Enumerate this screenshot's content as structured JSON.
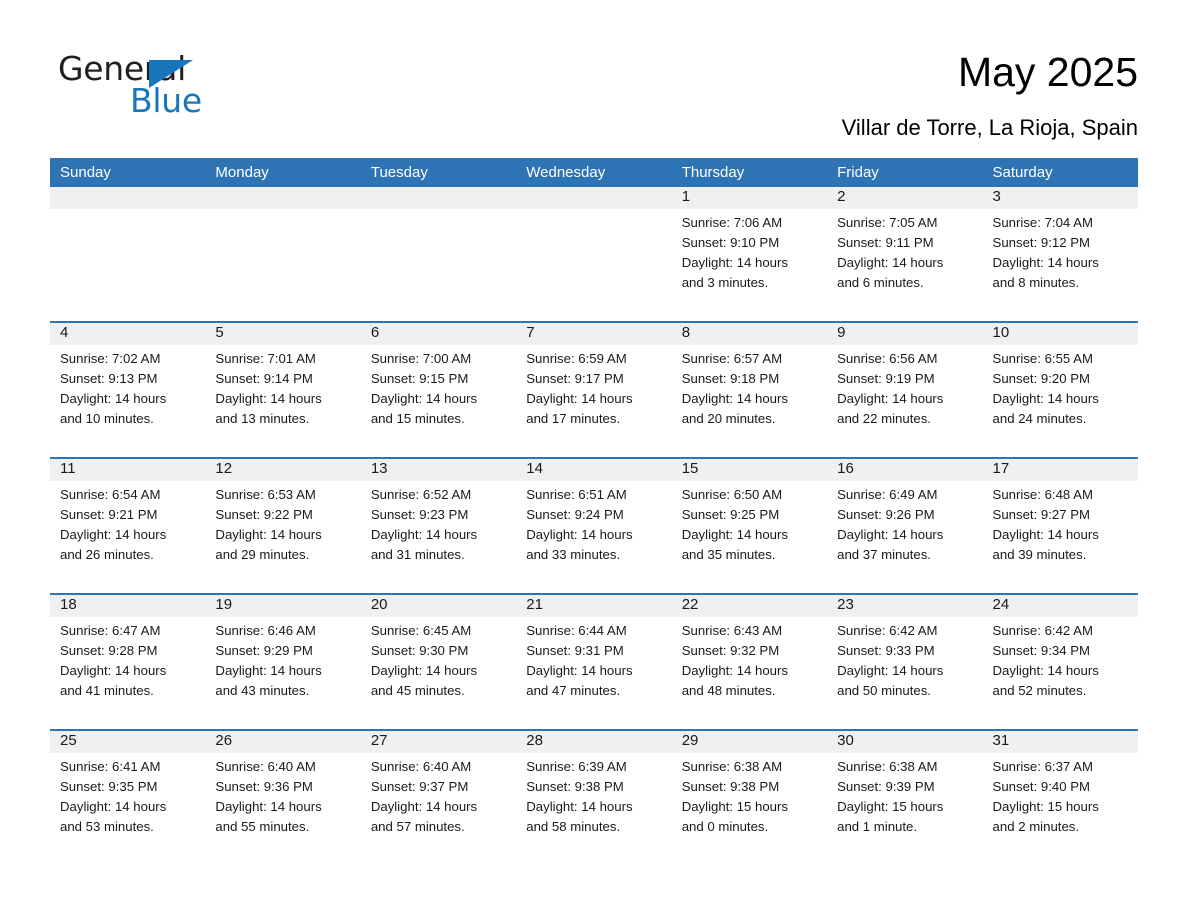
{
  "brand": {
    "name_part1": "General",
    "name_part2": "Blue",
    "accent_color": "#1a76bc"
  },
  "header": {
    "title": "May 2025",
    "subtitle": "Villar de Torre, La Rioja, Spain",
    "header_blue": "#2e74b5",
    "datestrip_gray": "#f0f0f0"
  },
  "calendar": {
    "weekday_headers": [
      "Sunday",
      "Monday",
      "Tuesday",
      "Wednesday",
      "Thursday",
      "Friday",
      "Saturday"
    ],
    "weeks": [
      [
        {
          "day": "",
          "empty": true
        },
        {
          "day": "",
          "empty": true
        },
        {
          "day": "",
          "empty": true
        },
        {
          "day": "",
          "empty": true
        },
        {
          "day": "1",
          "sunrise": "Sunrise: 7:06 AM",
          "sunset": "Sunset: 9:10 PM",
          "daylight_line1": "Daylight: 14 hours",
          "daylight_line2": "and 3 minutes."
        },
        {
          "day": "2",
          "sunrise": "Sunrise: 7:05 AM",
          "sunset": "Sunset: 9:11 PM",
          "daylight_line1": "Daylight: 14 hours",
          "daylight_line2": "and 6 minutes."
        },
        {
          "day": "3",
          "sunrise": "Sunrise: 7:04 AM",
          "sunset": "Sunset: 9:12 PM",
          "daylight_line1": "Daylight: 14 hours",
          "daylight_line2": "and 8 minutes."
        }
      ],
      [
        {
          "day": "4",
          "sunrise": "Sunrise: 7:02 AM",
          "sunset": "Sunset: 9:13 PM",
          "daylight_line1": "Daylight: 14 hours",
          "daylight_line2": "and 10 minutes."
        },
        {
          "day": "5",
          "sunrise": "Sunrise: 7:01 AM",
          "sunset": "Sunset: 9:14 PM",
          "daylight_line1": "Daylight: 14 hours",
          "daylight_line2": "and 13 minutes."
        },
        {
          "day": "6",
          "sunrise": "Sunrise: 7:00 AM",
          "sunset": "Sunset: 9:15 PM",
          "daylight_line1": "Daylight: 14 hours",
          "daylight_line2": "and 15 minutes."
        },
        {
          "day": "7",
          "sunrise": "Sunrise: 6:59 AM",
          "sunset": "Sunset: 9:17 PM",
          "daylight_line1": "Daylight: 14 hours",
          "daylight_line2": "and 17 minutes."
        },
        {
          "day": "8",
          "sunrise": "Sunrise: 6:57 AM",
          "sunset": "Sunset: 9:18 PM",
          "daylight_line1": "Daylight: 14 hours",
          "daylight_line2": "and 20 minutes."
        },
        {
          "day": "9",
          "sunrise": "Sunrise: 6:56 AM",
          "sunset": "Sunset: 9:19 PM",
          "daylight_line1": "Daylight: 14 hours",
          "daylight_line2": "and 22 minutes."
        },
        {
          "day": "10",
          "sunrise": "Sunrise: 6:55 AM",
          "sunset": "Sunset: 9:20 PM",
          "daylight_line1": "Daylight: 14 hours",
          "daylight_line2": "and 24 minutes."
        }
      ],
      [
        {
          "day": "11",
          "sunrise": "Sunrise: 6:54 AM",
          "sunset": "Sunset: 9:21 PM",
          "daylight_line1": "Daylight: 14 hours",
          "daylight_line2": "and 26 minutes."
        },
        {
          "day": "12",
          "sunrise": "Sunrise: 6:53 AM",
          "sunset": "Sunset: 9:22 PM",
          "daylight_line1": "Daylight: 14 hours",
          "daylight_line2": "and 29 minutes."
        },
        {
          "day": "13",
          "sunrise": "Sunrise: 6:52 AM",
          "sunset": "Sunset: 9:23 PM",
          "daylight_line1": "Daylight: 14 hours",
          "daylight_line2": "and 31 minutes."
        },
        {
          "day": "14",
          "sunrise": "Sunrise: 6:51 AM",
          "sunset": "Sunset: 9:24 PM",
          "daylight_line1": "Daylight: 14 hours",
          "daylight_line2": "and 33 minutes."
        },
        {
          "day": "15",
          "sunrise": "Sunrise: 6:50 AM",
          "sunset": "Sunset: 9:25 PM",
          "daylight_line1": "Daylight: 14 hours",
          "daylight_line2": "and 35 minutes."
        },
        {
          "day": "16",
          "sunrise": "Sunrise: 6:49 AM",
          "sunset": "Sunset: 9:26 PM",
          "daylight_line1": "Daylight: 14 hours",
          "daylight_line2": "and 37 minutes."
        },
        {
          "day": "17",
          "sunrise": "Sunrise: 6:48 AM",
          "sunset": "Sunset: 9:27 PM",
          "daylight_line1": "Daylight: 14 hours",
          "daylight_line2": "and 39 minutes."
        }
      ],
      [
        {
          "day": "18",
          "sunrise": "Sunrise: 6:47 AM",
          "sunset": "Sunset: 9:28 PM",
          "daylight_line1": "Daylight: 14 hours",
          "daylight_line2": "and 41 minutes."
        },
        {
          "day": "19",
          "sunrise": "Sunrise: 6:46 AM",
          "sunset": "Sunset: 9:29 PM",
          "daylight_line1": "Daylight: 14 hours",
          "daylight_line2": "and 43 minutes."
        },
        {
          "day": "20",
          "sunrise": "Sunrise: 6:45 AM",
          "sunset": "Sunset: 9:30 PM",
          "daylight_line1": "Daylight: 14 hours",
          "daylight_line2": "and 45 minutes."
        },
        {
          "day": "21",
          "sunrise": "Sunrise: 6:44 AM",
          "sunset": "Sunset: 9:31 PM",
          "daylight_line1": "Daylight: 14 hours",
          "daylight_line2": "and 47 minutes."
        },
        {
          "day": "22",
          "sunrise": "Sunrise: 6:43 AM",
          "sunset": "Sunset: 9:32 PM",
          "daylight_line1": "Daylight: 14 hours",
          "daylight_line2": "and 48 minutes."
        },
        {
          "day": "23",
          "sunrise": "Sunrise: 6:42 AM",
          "sunset": "Sunset: 9:33 PM",
          "daylight_line1": "Daylight: 14 hours",
          "daylight_line2": "and 50 minutes."
        },
        {
          "day": "24",
          "sunrise": "Sunrise: 6:42 AM",
          "sunset": "Sunset: 9:34 PM",
          "daylight_line1": "Daylight: 14 hours",
          "daylight_line2": "and 52 minutes."
        }
      ],
      [
        {
          "day": "25",
          "sunrise": "Sunrise: 6:41 AM",
          "sunset": "Sunset: 9:35 PM",
          "daylight_line1": "Daylight: 14 hours",
          "daylight_line2": "and 53 minutes."
        },
        {
          "day": "26",
          "sunrise": "Sunrise: 6:40 AM",
          "sunset": "Sunset: 9:36 PM",
          "daylight_line1": "Daylight: 14 hours",
          "daylight_line2": "and 55 minutes."
        },
        {
          "day": "27",
          "sunrise": "Sunrise: 6:40 AM",
          "sunset": "Sunset: 9:37 PM",
          "daylight_line1": "Daylight: 14 hours",
          "daylight_line2": "and 57 minutes."
        },
        {
          "day": "28",
          "sunrise": "Sunrise: 6:39 AM",
          "sunset": "Sunset: 9:38 PM",
          "daylight_line1": "Daylight: 14 hours",
          "daylight_line2": "and 58 minutes."
        },
        {
          "day": "29",
          "sunrise": "Sunrise: 6:38 AM",
          "sunset": "Sunset: 9:38 PM",
          "daylight_line1": "Daylight: 15 hours",
          "daylight_line2": "and 0 minutes."
        },
        {
          "day": "30",
          "sunrise": "Sunrise: 6:38 AM",
          "sunset": "Sunset: 9:39 PM",
          "daylight_line1": "Daylight: 15 hours",
          "daylight_line2": "and 1 minute."
        },
        {
          "day": "31",
          "sunrise": "Sunrise: 6:37 AM",
          "sunset": "Sunset: 9:40 PM",
          "daylight_line1": "Daylight: 15 hours",
          "daylight_line2": "and 2 minutes."
        }
      ]
    ]
  }
}
